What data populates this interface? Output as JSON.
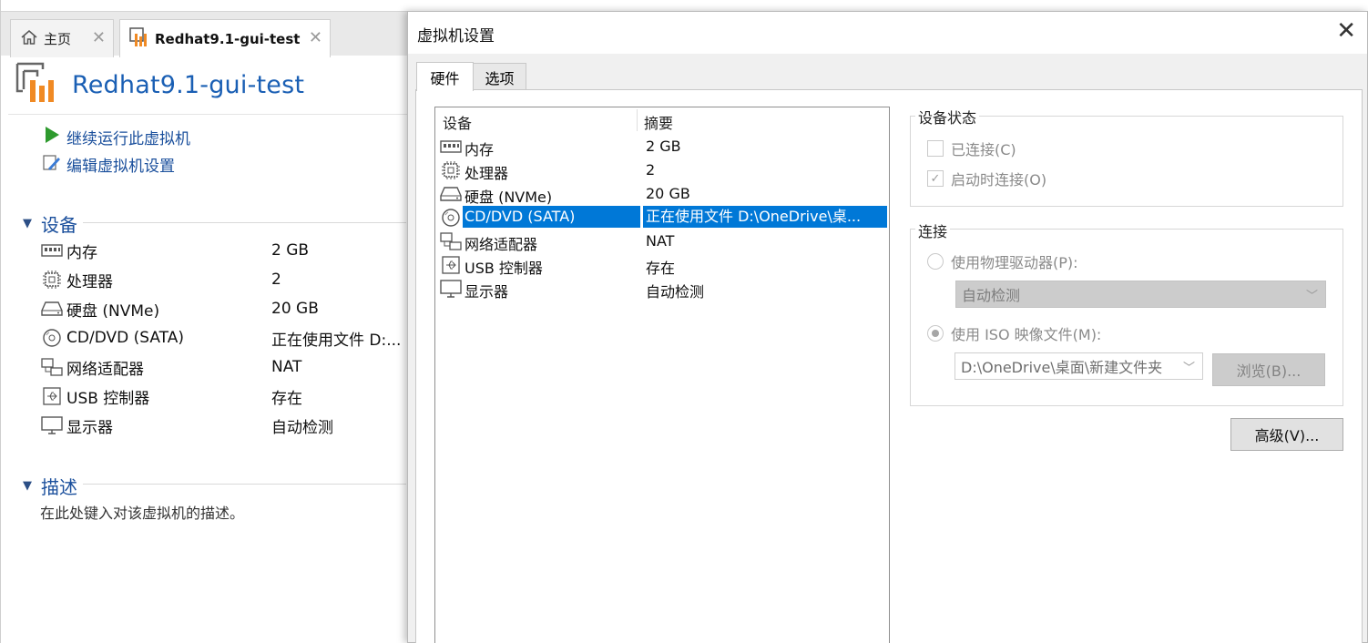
{
  "tabs": [
    {
      "label": "主页",
      "icon": "home-icon"
    },
    {
      "label": "Redhat9.1-gui-test",
      "icon": "vm-icon"
    }
  ],
  "vm": {
    "title": "Redhat9.1-gui-test",
    "actions": [
      {
        "label": "继续运行此虚拟机",
        "icon": "play-icon"
      },
      {
        "label": "编辑虚拟机设置",
        "icon": "edit-settings-icon"
      }
    ],
    "devices_heading": "设备",
    "devices": [
      {
        "name": "内存",
        "value": "2 GB",
        "icon": "memory-icon"
      },
      {
        "name": "处理器",
        "value": "2",
        "icon": "cpu-icon"
      },
      {
        "name": "硬盘 (NVMe)",
        "value": "20 GB",
        "icon": "harddisk-icon"
      },
      {
        "name": "CD/DVD (SATA)",
        "value": "正在使用文件 D:...",
        "icon": "cd-dvd-icon"
      },
      {
        "name": "网络适配器",
        "value": "NAT",
        "icon": "network-icon"
      },
      {
        "name": "USB 控制器",
        "value": "存在",
        "icon": "usb-icon"
      },
      {
        "name": "显示器",
        "value": "自动检测",
        "icon": "display-icon"
      }
    ],
    "description_heading": "描述",
    "description_placeholder": "在此处键入对该虚拟机的描述。"
  },
  "dialog": {
    "title": "虚拟机设置",
    "tabs": [
      "硬件",
      "选项"
    ],
    "list_headers": {
      "device": "设备",
      "summary": "摘要"
    },
    "devices": [
      {
        "name": "内存",
        "summary": "2 GB",
        "icon": "memory-icon",
        "selected": false
      },
      {
        "name": "处理器",
        "summary": "2",
        "icon": "cpu-icon",
        "selected": false
      },
      {
        "name": "硬盘 (NVMe)",
        "summary": "20 GB",
        "icon": "harddisk-icon",
        "selected": false
      },
      {
        "name": "CD/DVD (SATA)",
        "summary": "正在使用文件 D:\\OneDrive\\桌...",
        "icon": "cd-dvd-icon",
        "selected": true
      },
      {
        "name": "网络适配器",
        "summary": "NAT",
        "icon": "network-icon",
        "selected": false
      },
      {
        "name": "USB 控制器",
        "summary": "存在",
        "icon": "usb-icon",
        "selected": false
      },
      {
        "name": "显示器",
        "summary": "自动检测",
        "icon": "display-icon",
        "selected": false
      }
    ],
    "device_status": {
      "heading": "设备状态",
      "connected": {
        "label": "已连接(C)",
        "checked": false
      },
      "connect_at_power_on": {
        "label": "启动时连接(O)",
        "checked": true
      }
    },
    "connection": {
      "heading": "连接",
      "physical_drive": {
        "label": "使用物理驱动器(P):",
        "selected": false
      },
      "physical_drive_value": "自动检测",
      "iso_image": {
        "label": "使用 ISO 映像文件(M):",
        "selected": true
      },
      "iso_path": "D:\\OneDrive\\桌面\\新建文件夹",
      "browse_label": "浏览(B)..."
    },
    "advanced_label": "高级(V)..."
  },
  "colors": {
    "accent": "#1a5fb4",
    "selection": "#0078d7",
    "vm_orange": "#f08a24",
    "play_green": "#2e9a2e"
  }
}
